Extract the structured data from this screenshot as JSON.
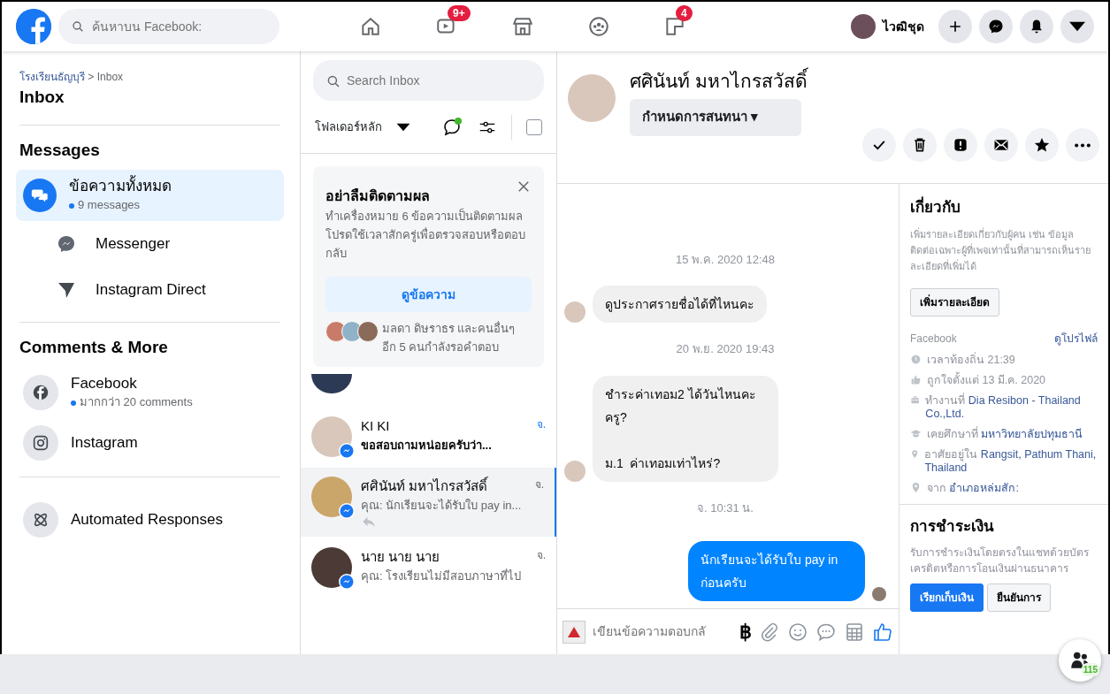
{
  "top_bar": {
    "search": {
      "placeholder": "ค้นหาบน Facebook:"
    },
    "nav": [
      {
        "kind": "home"
      },
      {
        "kind": "video",
        "badge": "9+"
      },
      {
        "kind": "store"
      },
      {
        "kind": "groups"
      },
      {
        "kind": "pages",
        "badge": "4"
      }
    ],
    "profile": {
      "name": "ไวฒิชุด"
    },
    "actions": [
      {
        "kind": "plus"
      },
      {
        "kind": "messenger"
      },
      {
        "kind": "bell"
      },
      {
        "kind": "caret"
      }
    ]
  },
  "sidebar": {
    "breadcrumb": {
      "link": "โรงเรียนธัญบุรี",
      "separator": ">",
      "current": "Inbox"
    },
    "title": "Inbox",
    "sections": [
      {
        "heading": "Messages",
        "items": [
          {
            "kind": "chat",
            "label": "ข้อความทั้งหมด",
            "sub": "9 messages",
            "selected": true
          },
          {
            "kind": "messenger",
            "label": "Messenger",
            "selected": false
          },
          {
            "kind": "direct",
            "label": "Instagram Direct",
            "selected": false
          }
        ]
      },
      {
        "heading": "Comments & More",
        "items": [
          {
            "kind": "facebook",
            "label": "Facebook",
            "sub": "มากกว่า 20 comments",
            "selected": false
          },
          {
            "kind": "instagram",
            "label": "Instagram",
            "selected": false
          }
        ]
      },
      {
        "items": [
          {
            "kind": "atom",
            "label": "Automated Responses",
            "selected": false
          }
        ]
      }
    ]
  },
  "inbox": {
    "search": {
      "placeholder": "Search Inbox"
    },
    "folder": "โฟลเดอร์หลัก",
    "select_all": {
      "checked": false
    },
    "notice": {
      "title": "อย่าลืมติดตามผล",
      "body": "ทำเครื่องหมาย 6 ข้อความเป็นติดตามผล โปรดใช้เวลาสักครู่เพื่อตรวจสอบหรือตอบกลับ",
      "button": "ดูข้อความ",
      "footer": "มลดา ดิษราธร และคนอื่นๆ อีก 5 คนกำลังรอคำตอบ"
    },
    "conversations": [
      {
        "kind": "partial",
        "selected": false
      },
      {
        "kind": "full",
        "name": "KI KI",
        "preview": "ขอสอบถามหน่อยครับว่า...",
        "time": "จ.",
        "selected": false,
        "unread": true,
        "replied": false
      },
      {
        "kind": "full",
        "name": "ศศินันท์ มหาไกรสวัสดิ์",
        "preview": "คุณ: นักเรียนจะได้รับใบ pay in...",
        "time": "จ.",
        "selected": true,
        "unread": false,
        "replied": true
      },
      {
        "kind": "full",
        "name": "นาย นาย นาย",
        "preview": "คุณ: โรงเรียนไม่มีสอบภาษาที่ไป",
        "time": "จ.",
        "selected": false,
        "unread": false,
        "replied": false
      }
    ]
  },
  "conversation": {
    "name": "ศศินันท์ มหาไกรสวัสดิ์",
    "assign": "กำหนดการสนทนา ▾",
    "actions": [
      {
        "kind": "check"
      },
      {
        "kind": "trash"
      },
      {
        "kind": "alert"
      },
      {
        "kind": "mail"
      },
      {
        "kind": "star"
      },
      {
        "kind": "more"
      }
    ],
    "messages": [
      {
        "kind": "timestamp",
        "text": "15 พ.ค. 2020 12:48"
      },
      {
        "kind": "incoming",
        "text": "ดูประกาศรายชื่อได้ที่ไหนคะ"
      },
      {
        "kind": "timestamp",
        "text": "20 พ.ย. 2020 19:43"
      },
      {
        "kind": "incoming",
        "text": "ชำระค่าเทอม2 ได้วันไหนคะครู?\n\nม.1  ค่าเทอมเท่าไหร่?"
      },
      {
        "kind": "timestamp",
        "text": "จ. 10:31 น."
      },
      {
        "kind": "outgoing",
        "text": "นักเรียนจะได้รับใบ pay in ก่อนครับ"
      }
    ],
    "composer": {
      "placeholder": "เขียนข้อความตอบกลั",
      "currency": "฿",
      "tools": [
        {
          "kind": "paperclip"
        },
        {
          "kind": "smiley"
        },
        {
          "kind": "comment"
        },
        {
          "kind": "table"
        },
        {
          "kind": "like"
        }
      ]
    }
  },
  "details": {
    "title": "เกี่ยวกับ",
    "description": "เพิ่มรายละเอียดเกี่ยวกับผู้คน เช่น ข้อมูลติดต่อเฉพาะผู้ที่เพจเท่านั้นที่สามารถเห็นรายละเอียดที่เพิ่มได้",
    "add_button": "เพิ่มรายละเอียด",
    "source": "Facebook",
    "profile_link": "ดูโปรไฟล์",
    "rows": [
      {
        "kind": "clock",
        "text": "เวลาท้องถิ่น 21:39"
      },
      {
        "kind": "like",
        "text": "ถูกใจตั้งแต่ 13 มี.ค. 2020"
      },
      {
        "kind": "work",
        "text": "ทำงานที่",
        "value": "Dia Resibon - Thailand Co.,Ltd."
      },
      {
        "kind": "school",
        "text": "เคยศึกษาที่",
        "value": "มหาวิทยาลัยปทุมธานี"
      },
      {
        "kind": "pin",
        "text": "อาศัยอยู่ใน",
        "value": "Rangsit, Pathum Thani, Thailand"
      },
      {
        "kind": "pin",
        "text": "จาก",
        "value": "อำเภอหล่มสัก:"
      }
    ],
    "payments": {
      "title": "การชำระเงิน",
      "description": "รับการชำระเงินโดยตรงในแชทด้วยบัตรเครดิตหรือการโอนเงินผ่านธนาคาร",
      "buttons": [
        {
          "kind": "primary",
          "label": "เรียกเก็บเงิน"
        },
        {
          "kind": "secondary",
          "label": "ยืนยันการ"
        }
      ]
    }
  },
  "chat_head": {
    "count": "115"
  }
}
